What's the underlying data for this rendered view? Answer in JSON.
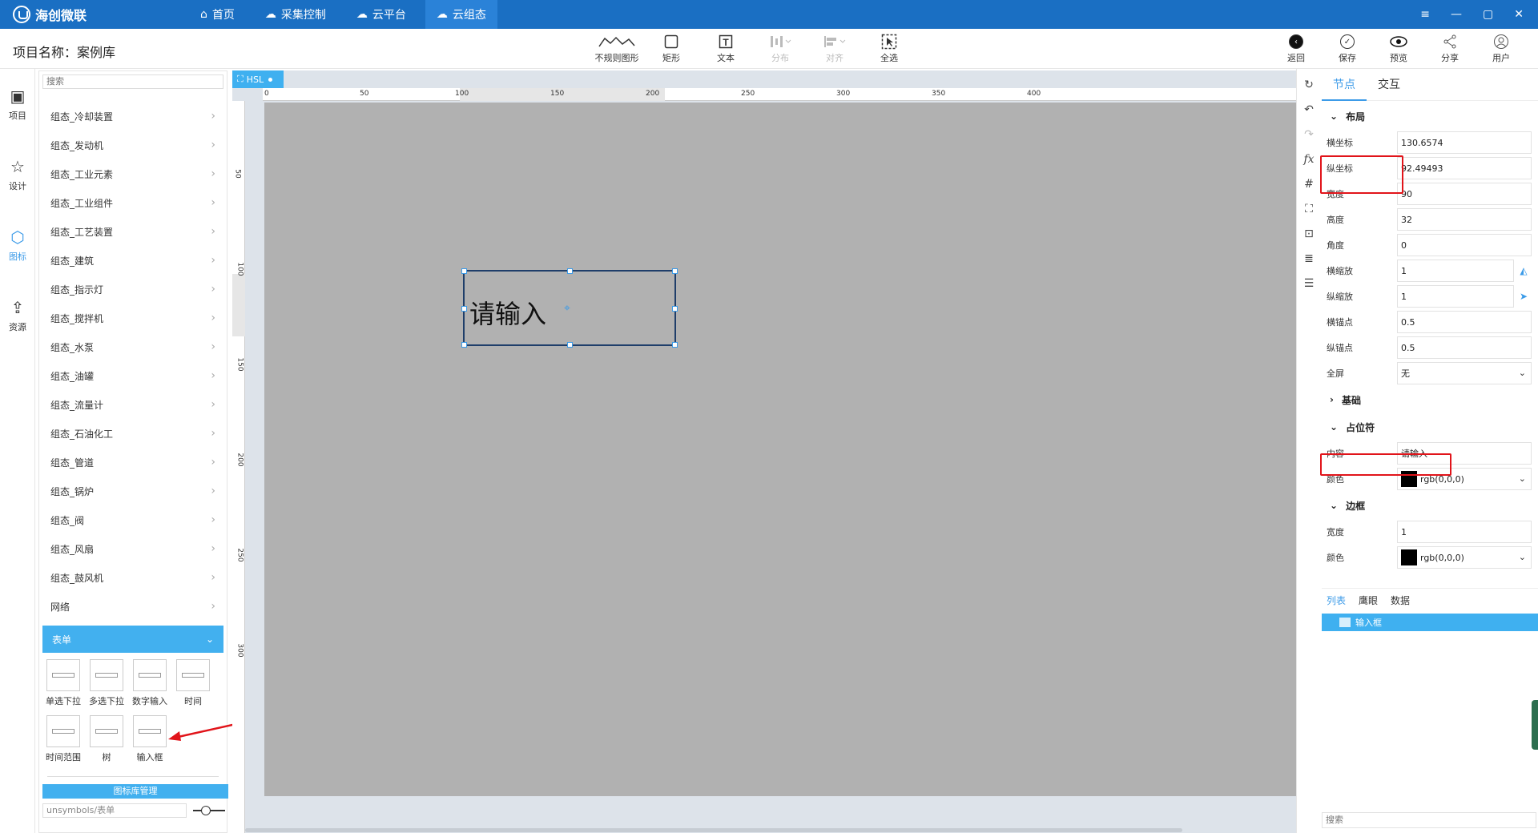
{
  "app": {
    "name": "海创微联",
    "nav": [
      {
        "label": "首页",
        "icon": "home-icon"
      },
      {
        "label": "采集控制",
        "icon": "cloud-sync-icon"
      },
      {
        "label": "云平台",
        "icon": "cloud-platform-icon"
      },
      {
        "label": "云组态",
        "icon": "cloud-config-icon"
      }
    ],
    "window_controls": [
      "≡",
      "—",
      "▢",
      "✕"
    ]
  },
  "header": {
    "project": "项目名称：案例库",
    "tools": [
      {
        "label": "不规则图形",
        "icon": "irregular-shape-icon",
        "enabled": true
      },
      {
        "label": "矩形",
        "icon": "rectangle-icon",
        "enabled": true
      },
      {
        "label": "文本",
        "icon": "text-icon",
        "enabled": true
      },
      {
        "label": "分布",
        "icon": "distribute-icon",
        "enabled": false
      },
      {
        "label": "对齐",
        "icon": "align-icon",
        "enabled": false
      },
      {
        "label": "全选",
        "icon": "select-all-icon",
        "enabled": true
      }
    ],
    "right_tools": [
      {
        "label": "返回",
        "icon": "back-icon"
      },
      {
        "label": "保存",
        "icon": "save-icon"
      },
      {
        "label": "预览",
        "icon": "preview-icon"
      },
      {
        "label": "分享",
        "icon": "share-icon"
      },
      {
        "label": "用户",
        "icon": "user-icon"
      }
    ]
  },
  "rail": [
    {
      "label": "项目",
      "icon": "image-icon",
      "active": false
    },
    {
      "label": "设计",
      "icon": "star-icon",
      "active": false
    },
    {
      "label": "图标",
      "icon": "shapes-icon",
      "active": true
    },
    {
      "label": "资源",
      "icon": "upload-cloud-icon",
      "active": false
    }
  ],
  "library": {
    "search_placeholder": "搜索",
    "items": [
      "组态_冷却装置",
      "组态_发动机",
      "组态_工业元素",
      "组态_工业组件",
      "组态_工艺装置",
      "组态_建筑",
      "组态_指示灯",
      "组态_搅拌机",
      "组态_水泵",
      "组态_油罐",
      "组态_流量计",
      "组态_石油化工",
      "组态_管道",
      "组态_锅炉",
      "组态_阀",
      "组态_风扇",
      "组态_鼓风机",
      "网络"
    ],
    "expanded": "表单",
    "form_tiles": [
      "单选下拉",
      "多选下拉",
      "数字输入",
      "时间",
      "时间范围",
      "树",
      "输入框"
    ],
    "manage_label": "图标库管理",
    "path_value": "unsymbols/表单"
  },
  "canvas": {
    "tab": "HSL",
    "h_ticks": [
      "0",
      "50",
      "100",
      "150",
      "200",
      "250",
      "300",
      "350",
      "400"
    ],
    "v_ticks": [
      "50",
      "100",
      "150",
      "200",
      "250",
      "300"
    ],
    "node_text": "请输入"
  },
  "properties": {
    "tabs": [
      "节点",
      "交互"
    ],
    "layout": {
      "title": "布局",
      "rows": [
        {
          "k": "横坐标",
          "v": "130.6574"
        },
        {
          "k": "纵坐标",
          "v": "92.49493"
        },
        {
          "k": "宽度",
          "v": "90"
        },
        {
          "k": "高度",
          "v": "32"
        },
        {
          "k": "角度",
          "v": "0"
        },
        {
          "k": "横缩放",
          "v": "1"
        },
        {
          "k": "纵缩放",
          "v": "1"
        },
        {
          "k": "横锚点",
          "v": "0.5"
        },
        {
          "k": "纵锚点",
          "v": "0.5"
        },
        {
          "k": "全屏",
          "v": "无"
        }
      ]
    },
    "basic_title": "基础",
    "placeholder": {
      "title": "占位符",
      "content_label": "内容",
      "content_value": "请输入",
      "color_label": "颜色",
      "color_value": "rgb(0,0,0)"
    },
    "border": {
      "title": "边框",
      "width_label": "宽度",
      "width_value": "1",
      "color_label": "颜色",
      "color_value": "rgb(0,0,0)"
    },
    "bottom_tabs": [
      "列表",
      "鹰眼",
      "数据"
    ],
    "tree_item": "输入框",
    "search_placeholder": "搜索"
  }
}
